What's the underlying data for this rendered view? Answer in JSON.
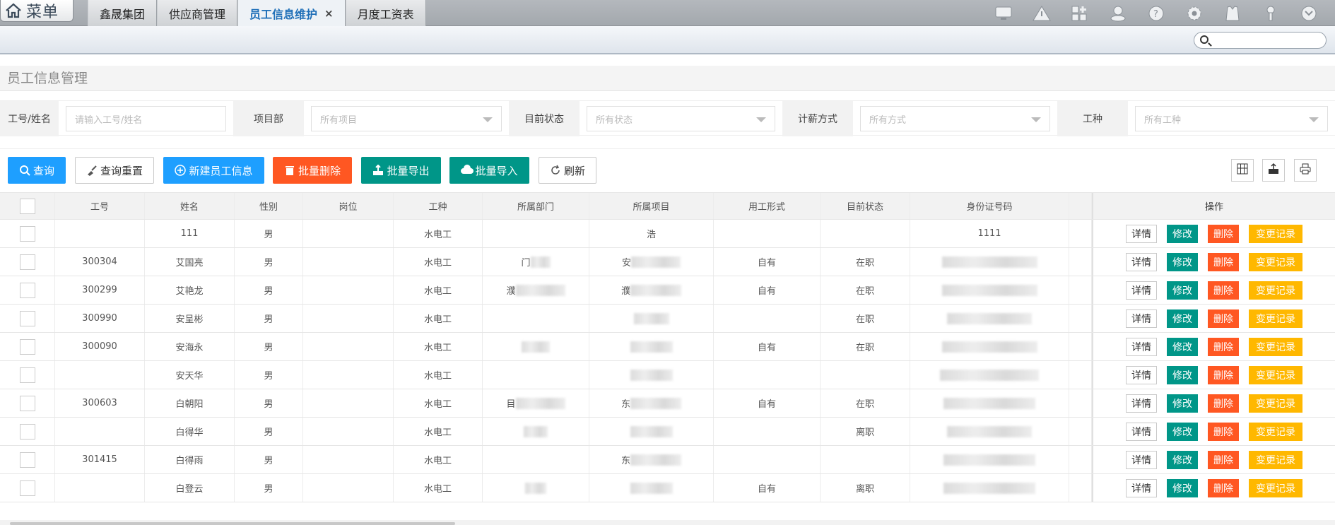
{
  "topbar": {
    "menu_label": "菜单",
    "tabs": [
      {
        "label": "鑫晟集团"
      },
      {
        "label": "供应商管理"
      },
      {
        "label": "员工信息维护",
        "active": true,
        "close": "×"
      },
      {
        "label": "月度工资表"
      }
    ],
    "sys_icons": [
      "monitor-icon",
      "warning-icon",
      "add-window-icon",
      "user-icon",
      "help-icon",
      "settings-icon",
      "shirt-icon",
      "key-icon",
      "dropdown-icon"
    ]
  },
  "page_title": "员工信息管理",
  "filters": [
    {
      "label": "工号/姓名",
      "placeholder": "请输入工号/姓名",
      "type": "input"
    },
    {
      "label": "项目部",
      "value": "所有项目",
      "type": "select"
    },
    {
      "label": "目前状态",
      "value": "所有状态",
      "type": "select"
    },
    {
      "label": "计薪方式",
      "value": "所有方式",
      "type": "select"
    },
    {
      "label": "工种",
      "value": "所有工种",
      "type": "select"
    }
  ],
  "toolbar": {
    "query": "查询",
    "reset": "查询重置",
    "new": "新建员工信息",
    "batch_delete": "批量删除",
    "batch_export": "批量导出",
    "batch_import": "批量导入",
    "refresh": "刷新"
  },
  "table": {
    "headers": [
      "工号",
      "姓名",
      "性别",
      "岗位",
      "工种",
      "所属部门",
      "所属项目",
      "用工形式",
      "目前状态",
      "身份证号码",
      "操作"
    ],
    "op_labels": {
      "detail": "详情",
      "edit": "修改",
      "delete": "删除",
      "log": "变更记录"
    },
    "rows": [
      {
        "id": "",
        "name": "111",
        "gender": "男",
        "post": "",
        "trade": "水电工",
        "dept": "",
        "project": "浩",
        "form": "",
        "status": "",
        "idcard": "1111"
      },
      {
        "id": "300304",
        "name": "艾国亮",
        "gender": "男",
        "post": "",
        "trade": "水电工",
        "dept": "门",
        "project": "安",
        "form": "自有",
        "status": "在职",
        "idcard": ""
      },
      {
        "id": "300299",
        "name": "艾艳龙",
        "gender": "男",
        "post": "",
        "trade": "水电工",
        "dept": "濮",
        "project": "濮",
        "form": "自有",
        "status": "在职",
        "idcard": ""
      },
      {
        "id": "300990",
        "name": "安呈彬",
        "gender": "男",
        "post": "",
        "trade": "水电工",
        "dept": "",
        "project": "",
        "form": "",
        "status": "在职",
        "idcard": ""
      },
      {
        "id": "300090",
        "name": "安海永",
        "gender": "男",
        "post": "",
        "trade": "水电工",
        "dept": "",
        "project": "",
        "form": "自有",
        "status": "在职",
        "idcard": ""
      },
      {
        "id": "",
        "name": "安天华",
        "gender": "男",
        "post": "",
        "trade": "水电工",
        "dept": "",
        "project": "",
        "form": "",
        "status": "",
        "idcard": ""
      },
      {
        "id": "300603",
        "name": "白朝阳",
        "gender": "男",
        "post": "",
        "trade": "水电工",
        "dept": "目",
        "project": "东",
        "form": "自有",
        "status": "在职",
        "idcard": ""
      },
      {
        "id": "",
        "name": "白得华",
        "gender": "男",
        "post": "",
        "trade": "水电工",
        "dept": "",
        "project": "",
        "form": "",
        "status": "离职",
        "idcard": ""
      },
      {
        "id": "301415",
        "name": "白得雨",
        "gender": "男",
        "post": "",
        "trade": "水电工",
        "dept": "",
        "project": "东",
        "form": "",
        "status": "",
        "idcard": ""
      },
      {
        "id": "",
        "name": "白登云",
        "gender": "男",
        "post": "",
        "trade": "水电工",
        "dept": "",
        "project": "",
        "form": "自有",
        "status": "离职",
        "idcard": ""
      }
    ]
  },
  "colors": {
    "blue": "#1e9fff",
    "orange": "#ff5722",
    "teal": "#009688",
    "yellow": "#ffb800"
  }
}
